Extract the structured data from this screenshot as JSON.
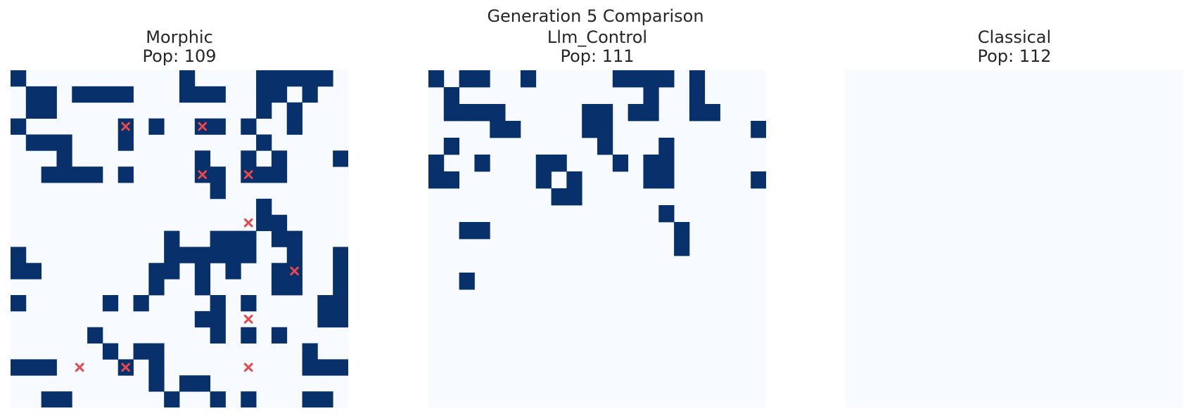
{
  "suptitle": "Generation 5 Comparison",
  "colors": {
    "alive": "#08306b",
    "dead": "#f7fbff",
    "marker": "#e8474c"
  },
  "chart_data": [
    {
      "type": "heatmap",
      "title_line1": "Morphic",
      "title_line2": "Pop: 109",
      "grid": [
        "1000000000010000111110",
        "0110111100011100110100",
        "0110000000000000101000",
        "1000000101001101001000",
        "0111000100000000100000",
        "0001000000001001010001",
        "0011110100001101110000",
        "0000000000000100000000",
        "0000000000000000100000",
        "0000000000000000110000",
        "0000000000100111011000",
        "1000000000111111001001",
        "1100000001101010011001",
        "0000000001001000011001",
        "1000001010000101000011",
        "0000000000001100000011",
        "0000010000000101010000",
        "0000001011000000000100",
        "1110000101000000000111",
        "0000000001011000000000",
        "0011000000100101000110"
      ],
      "markers": [
        [
          7,
          3
        ],
        [
          12,
          3
        ],
        [
          12,
          6
        ],
        [
          15,
          6
        ],
        [
          15,
          9
        ],
        [
          18,
          12
        ],
        [
          15,
          15
        ],
        [
          4,
          18
        ],
        [
          7,
          18
        ],
        [
          15,
          18
        ]
      ]
    },
    {
      "type": "heatmap",
      "title_line1": "Llm_Control",
      "title_line2": "Pop: 111",
      "grid": [
        "1011001000001111010000",
        "0100000000000010010000",
        "0111100000110110011000",
        "0000110000110000000001",
        "0100000000010001000000",
        "1001000110001011000000",
        "1100000101000011000001",
        "0000000011000000000000",
        "0000000000000001000000",
        "0011000000000000100000",
        "0000000000000000100000",
        "0000000000000000000000",
        "0010000000000000000000",
        "0000000000000000000000",
        "0000000000000000000000",
        "0000000000000000000000",
        "0000000000000000000000",
        "0000000000000000000000",
        "0000000000000000000000",
        "0000000000000000000000"
      ],
      "markers": []
    },
    {
      "type": "heatmap",
      "title_line1": "Classical",
      "title_line2": "Pop: 112",
      "grid": [
        "0000000000000000000000",
        "0000000000000000000000",
        "0000000000000000000000",
        "0000000000000000000000",
        "0000000000000000000000",
        "0000000000000000000000",
        "0000000000000000000000",
        "0000000000000000000000",
        "0000000000000000000000",
        "0000000000000000000000",
        "0000000000000000000000",
        "0000000000000000000000",
        "0000000000000000000000",
        "0000000000000000000000",
        "0000000000000000000000",
        "0000000000000000000000",
        "0000000000000000000000",
        "0000000000000000000000",
        "0000000000000000000000",
        "0000000000000000000000"
      ],
      "markers": []
    }
  ]
}
